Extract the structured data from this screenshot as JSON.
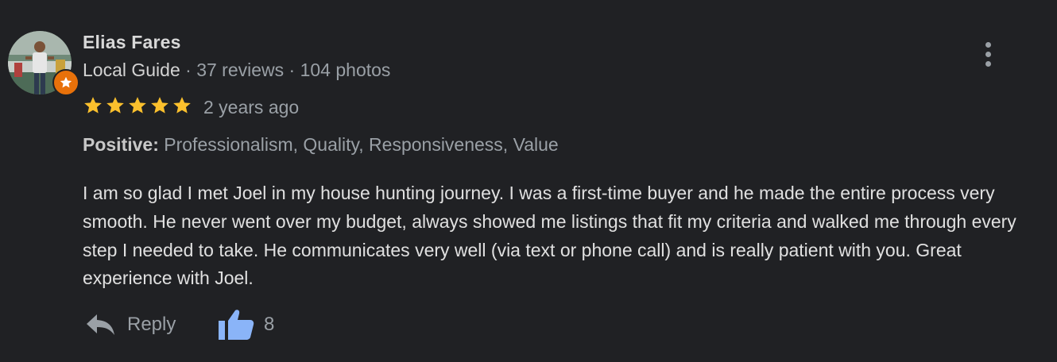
{
  "reviewer": {
    "name": "Elias Fares",
    "guide_label": "Local Guide",
    "separator": " · ",
    "reviews": "37 reviews",
    "photos": "104 photos"
  },
  "rating": {
    "stars": 5,
    "max": 5,
    "date": "2 years ago"
  },
  "positive": {
    "label": "Positive:",
    "items": "Professionalism, Quality, Responsiveness, Value"
  },
  "review_text": "I am so glad I met Joel in my house hunting journey. I was a first-time buyer and he made the entire process very smooth. He never went over my budget, always showed me listings that fit my criteria and walked me through every step I needed to take. He communicates very well (via text or phone call) and is really patient with you. Great experience with Joel.",
  "actions": {
    "reply_label": "Reply",
    "like_count": "8"
  },
  "icons": {
    "menu": "more-vert-icon",
    "reply": "reply-arrow-icon",
    "like": "thumbs-up-icon",
    "badge": "local-guide-star-icon"
  },
  "colors": {
    "background": "#202124",
    "star": "#fbc02d",
    "like": "#8ab4f8",
    "badge": "#e8710a"
  }
}
